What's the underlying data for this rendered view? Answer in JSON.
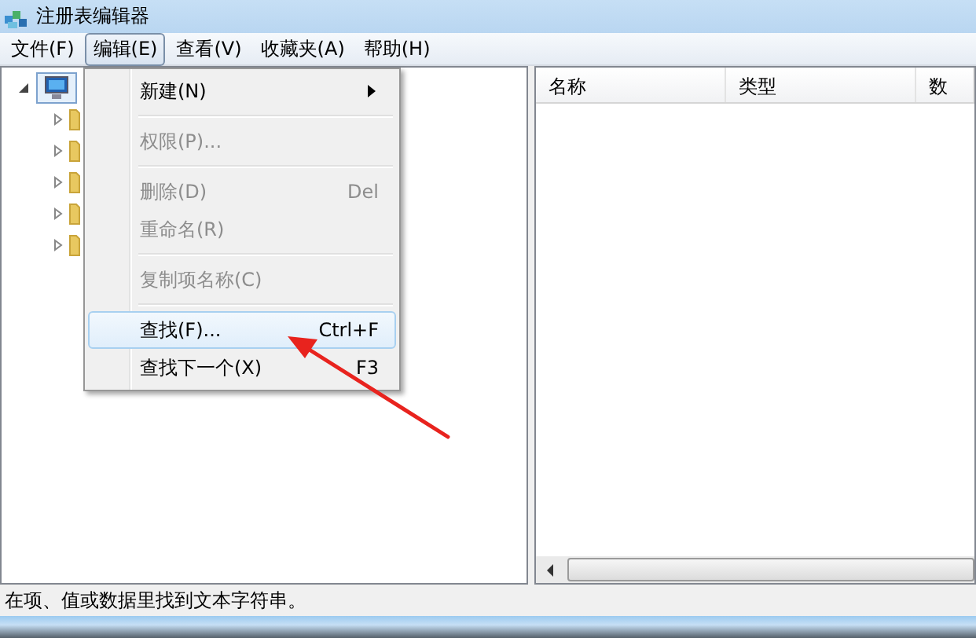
{
  "window": {
    "title": "注册表编辑器"
  },
  "menu_bar": [
    {
      "label": "文件(F)",
      "selected": false
    },
    {
      "label": "编辑(E)",
      "selected": true
    },
    {
      "label": "查看(V)",
      "selected": false
    },
    {
      "label": "收藏夹(A)",
      "selected": false
    },
    {
      "label": "帮助(H)",
      "selected": false
    }
  ],
  "edit_menu": [
    {
      "kind": "item",
      "label": "新建(N)",
      "submenu": true,
      "disabled": false,
      "selected": false
    },
    {
      "kind": "separator"
    },
    {
      "kind": "item",
      "label": "权限(P)...",
      "disabled": true,
      "selected": false
    },
    {
      "kind": "separator"
    },
    {
      "kind": "item",
      "label": "删除(D)",
      "shortcut": "Del",
      "disabled": true,
      "selected": false
    },
    {
      "kind": "item",
      "label": "重命名(R)",
      "disabled": true,
      "selected": false
    },
    {
      "kind": "separator"
    },
    {
      "kind": "item",
      "label": "复制项名称(C)",
      "disabled": true,
      "selected": false
    },
    {
      "kind": "separator"
    },
    {
      "kind": "item",
      "label": "查找(F)...",
      "shortcut": "Ctrl+F",
      "disabled": false,
      "selected": true
    },
    {
      "kind": "item",
      "label": "查找下一个(X)",
      "shortcut": "F3",
      "disabled": false,
      "selected": false
    }
  ],
  "tree": {
    "root": {
      "expanded": true,
      "selected": true,
      "children": [
        {
          "expanded": false
        },
        {
          "expanded": false
        },
        {
          "expanded": false
        },
        {
          "expanded": false
        },
        {
          "expanded": false
        }
      ]
    }
  },
  "table": {
    "columns": [
      "名称",
      "类型",
      "数"
    ]
  },
  "status_bar": "在项、值或数据里找到文本字符串。"
}
